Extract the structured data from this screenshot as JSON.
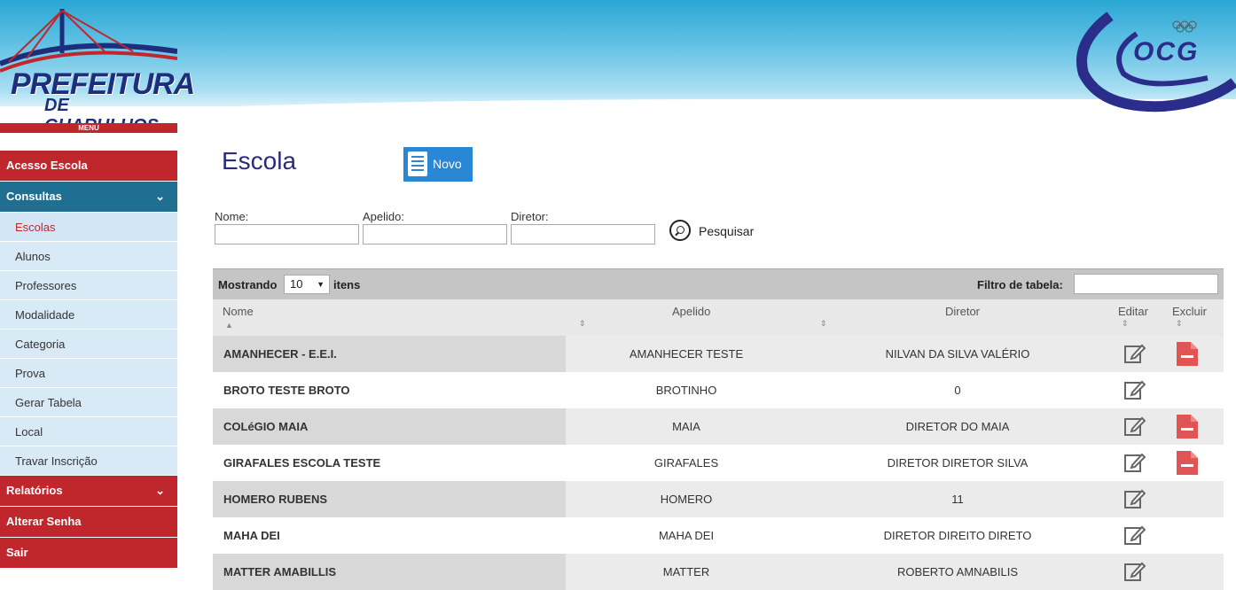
{
  "header": {
    "logo_left_line1": "PREFEITURA",
    "logo_left_line2": "DE GUARULHOS",
    "logo_right": "OCG"
  },
  "menu_label": "MENU",
  "sidebar": {
    "items": [
      {
        "label": "Acesso Escola"
      },
      {
        "label": "Consultas"
      },
      {
        "label": "Relatórios"
      },
      {
        "label": "Alterar Senha"
      },
      {
        "label": "Sair"
      }
    ],
    "sub_items": [
      {
        "label": "Escolas"
      },
      {
        "label": "Alunos"
      },
      {
        "label": "Professores"
      },
      {
        "label": "Modalidade"
      },
      {
        "label": "Categoria"
      },
      {
        "label": "Prova"
      },
      {
        "label": "Gerar Tabela"
      },
      {
        "label": "Local"
      },
      {
        "label": "Travar Inscrição"
      }
    ]
  },
  "page": {
    "title": "Escola",
    "new_button": "Novo"
  },
  "filters": {
    "nome_label": "Nome:",
    "nome_value": "",
    "apelido_label": "Apelido:",
    "apelido_value": "",
    "diretor_label": "Diretor:",
    "diretor_value": "",
    "search_label": "Pesquisar"
  },
  "table_bar": {
    "showing": "Mostrando",
    "page_size": "10",
    "items": "itens",
    "filter_label": "Filtro de tabela:",
    "filter_value": ""
  },
  "table": {
    "columns": [
      "Nome",
      "Apelido",
      "Diretor",
      "Editar",
      "Excluir"
    ],
    "rows": [
      {
        "nome": "AMANHECER - E.E.I.",
        "apelido": "AMANHECER TESTE",
        "diretor": "NILVAN DA SILVA VALÉRIO",
        "deletable": true
      },
      {
        "nome": "BROTO TESTE BROTO",
        "apelido": "BROTINHO",
        "diretor": "0",
        "deletable": false
      },
      {
        "nome": "COLéGIO MAIA",
        "apelido": "MAIA",
        "diretor": "DIRETOR DO MAIA",
        "deletable": true
      },
      {
        "nome": "GIRAFALES ESCOLA TESTE",
        "apelido": "GIRAFALES",
        "diretor": "DIRETOR DIRETOR SILVA",
        "deletable": true
      },
      {
        "nome": "HOMERO RUBENS",
        "apelido": "HOMERO",
        "diretor": "11",
        "deletable": false
      },
      {
        "nome": "MAHA DEI",
        "apelido": "MAHA DEI",
        "diretor": "DIRETOR DIREITO DIRETO",
        "deletable": false
      },
      {
        "nome": "MATTER AMABILLIS",
        "apelido": "MATTER",
        "diretor": "ROBERTO AMNABILIS",
        "deletable": false
      }
    ]
  },
  "colors": {
    "sidebar_red": "#c0272d",
    "sidebar_blue": "#1f6f93",
    "submenu_bg": "#d9eaf7",
    "title": "#2b2b7a",
    "new_button": "#2a87d6",
    "delete_icon": "#e05454"
  }
}
